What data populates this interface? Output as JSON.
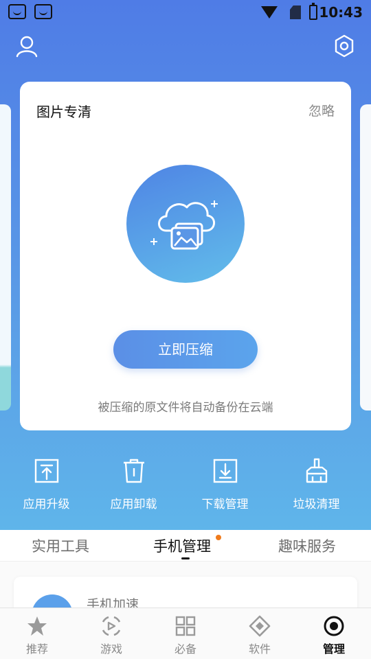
{
  "status_bar": {
    "time": "10:43"
  },
  "card": {
    "title": "图片专清",
    "ignore_label": "忽略",
    "button_label": "立即压缩",
    "note": "被压缩的原文件将自动备份在云端"
  },
  "tools": [
    {
      "label": "应用升级",
      "icon": "app-upgrade-icon"
    },
    {
      "label": "应用卸载",
      "icon": "trash-icon"
    },
    {
      "label": "下载管理",
      "icon": "download-icon"
    },
    {
      "label": "垃圾清理",
      "icon": "broom-icon"
    }
  ],
  "tabs": [
    {
      "label": "实用工具",
      "active": false
    },
    {
      "label": "手机管理",
      "active": true,
      "badge": true
    },
    {
      "label": "趣味服务",
      "active": false
    }
  ],
  "list_preview": {
    "first_item_label": "手机加速"
  },
  "bottom_nav": [
    {
      "label": "推荐",
      "icon": "star-icon",
      "active": false
    },
    {
      "label": "游戏",
      "icon": "game-icon",
      "active": false
    },
    {
      "label": "必备",
      "icon": "grid-icon",
      "active": false
    },
    {
      "label": "软件",
      "icon": "diamond-icon",
      "active": false
    },
    {
      "label": "管理",
      "icon": "settings-ring-icon",
      "active": true
    }
  ],
  "colors": {
    "hero_top": "#4f7ce6",
    "hero_bottom": "#5fb5ea",
    "badge": "#f07b1c"
  }
}
